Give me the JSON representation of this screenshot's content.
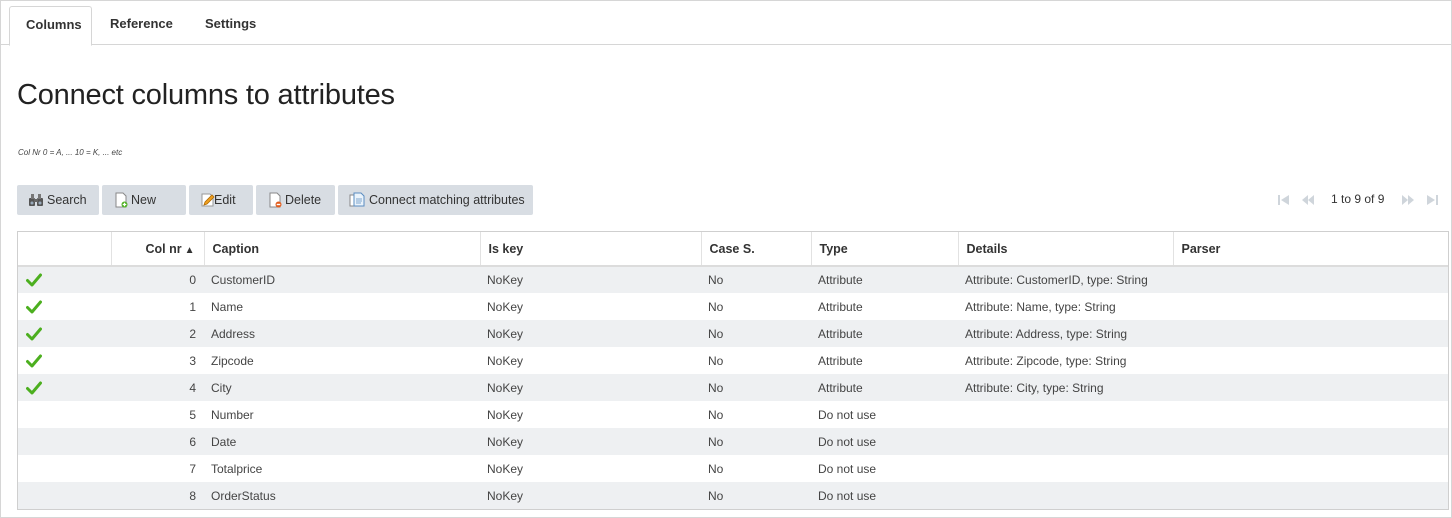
{
  "tabs": [
    {
      "label": "Columns",
      "active": true
    },
    {
      "label": "Reference",
      "active": false
    },
    {
      "label": "Settings",
      "active": false
    }
  ],
  "page": {
    "title": "Connect columns to attributes",
    "hint": "Col Nr 0 = A, ... 10 = K, ... etc"
  },
  "toolbar": {
    "search": "Search",
    "new": "New",
    "edit": "Edit",
    "delete": "Delete",
    "connect": "Connect matching attributes"
  },
  "pager": {
    "label": "1 to 9 of 9"
  },
  "grid": {
    "headers": {
      "status": "",
      "colnr": "Col nr",
      "sort_indicator": "▲",
      "caption": "Caption",
      "iskey": "Is key",
      "cases": "Case S.",
      "type": "Type",
      "details": "Details",
      "parser": "Parser"
    },
    "rows": [
      {
        "connected": true,
        "colnr": "0",
        "caption": "CustomerID",
        "iskey": "NoKey",
        "cases": "No",
        "type": "Attribute",
        "details": "Attribute: CustomerID, type: String",
        "parser": ""
      },
      {
        "connected": true,
        "colnr": "1",
        "caption": "Name",
        "iskey": "NoKey",
        "cases": "No",
        "type": "Attribute",
        "details": "Attribute: Name, type: String",
        "parser": ""
      },
      {
        "connected": true,
        "colnr": "2",
        "caption": "Address",
        "iskey": "NoKey",
        "cases": "No",
        "type": "Attribute",
        "details": "Attribute: Address, type: String",
        "parser": ""
      },
      {
        "connected": true,
        "colnr": "3",
        "caption": "Zipcode",
        "iskey": "NoKey",
        "cases": "No",
        "type": "Attribute",
        "details": "Attribute: Zipcode, type: String",
        "parser": ""
      },
      {
        "connected": true,
        "colnr": "4",
        "caption": "City",
        "iskey": "NoKey",
        "cases": "No",
        "type": "Attribute",
        "details": "Attribute: City, type: String",
        "parser": ""
      },
      {
        "connected": false,
        "colnr": "5",
        "caption": "Number",
        "iskey": "NoKey",
        "cases": "No",
        "type": "Do not use",
        "details": "",
        "parser": ""
      },
      {
        "connected": false,
        "colnr": "6",
        "caption": "Date",
        "iskey": "NoKey",
        "cases": "No",
        "type": "Do not use",
        "details": "",
        "parser": ""
      },
      {
        "connected": false,
        "colnr": "7",
        "caption": "Totalprice",
        "iskey": "NoKey",
        "cases": "No",
        "type": "Do not use",
        "details": "",
        "parser": ""
      },
      {
        "connected": false,
        "colnr": "8",
        "caption": "OrderStatus",
        "iskey": "NoKey",
        "cases": "No",
        "type": "Do not use",
        "details": "",
        "parser": ""
      }
    ]
  },
  "colors": {
    "button_bg": "#d8dde3",
    "row_alt": "#eef0f2",
    "check_green": "#4caf1f"
  },
  "icons": {
    "search": "binoculars-icon",
    "new": "new-document-icon",
    "edit": "edit-pencil-icon",
    "delete": "delete-document-icon",
    "connect": "connect-documents-icon",
    "row_status": "checkmark-icon"
  }
}
